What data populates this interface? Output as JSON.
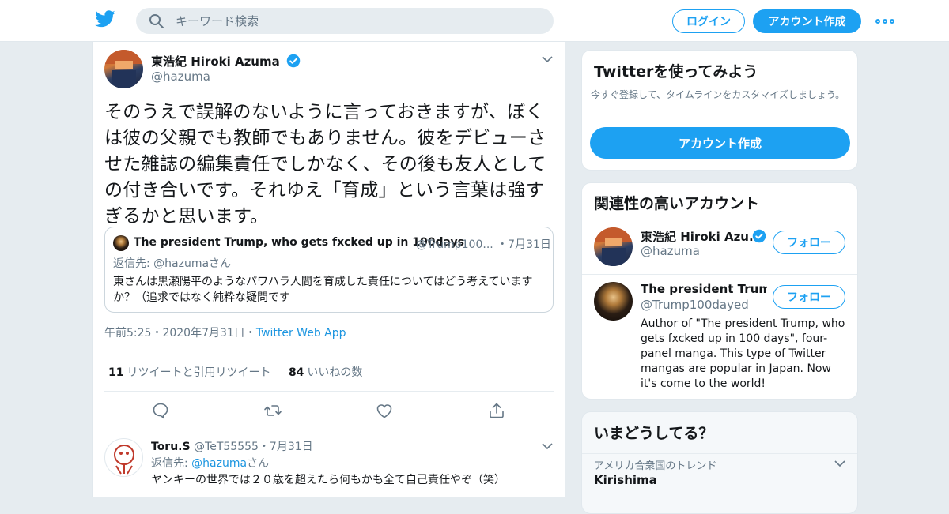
{
  "header": {
    "search_placeholder": "キーワード検索",
    "login_label": "ログイン",
    "signup_label": "アカウント作成",
    "brand_color": "#1da1f2"
  },
  "tweet": {
    "author_name": "東浩紀 Hiroki Azuma",
    "author_handle": "@hazuma",
    "text": "そのうえで誤解のないように言っておきますが、ぼくは彼の父親でも教師でもありません。彼をデビューさせた雑誌の編集責任でしかなく、その後も友人としての付き合いです。それゆえ「育成」という言葉は強すぎるかと思います。",
    "quoted": {
      "author_name": "The president Trump, who gets fxcked up in 100days",
      "author_handle": "@Trump100...",
      "date": "・7月31日",
      "reply_to": "返信先: @hazumaさん",
      "text": "東さんは黒瀬陽平のようなパワハラ人間を育成した責任についてはどう考えていますか？（追求ではなく純粋な疑問です"
    },
    "time": "午前5:25",
    "date": "・2020年7月31日・",
    "source": "Twitter Web App",
    "retweets_count": "11",
    "retweets_label": "リツイートと引用リツイート",
    "likes_count": "84",
    "likes_label": "いいねの数"
  },
  "reply": {
    "author_name": "Toru.S",
    "author_handle": "@TeT55555",
    "date": "・7月31日",
    "reply_prefix": "返信先: ",
    "reply_handle": "@hazuma",
    "reply_suffix": "さん",
    "text": "ヤンキーの世界では２０歳を超えたら何もかも全て自己責任やぞ（笑）"
  },
  "sidebar": {
    "signup_box": {
      "title": "Twitterを使ってみよう",
      "description": "今すぐ登録して、タイムラインをカスタマイズしましょう。",
      "button_label": "アカウント作成"
    },
    "relevant": {
      "title": "関連性の高いアカウント",
      "follow_label": "フォロー",
      "accounts": [
        {
          "name": "東浩紀 Hiroki Azu...",
          "handle": "@hazuma"
        },
        {
          "name": "The president Trump,...",
          "handle": "@Trump100dayed",
          "bio": "Author of \"The president Trump, who gets fxcked up in 100 days\", four-panel manga. This type of Twitter mangas are popular in Japan. Now it's come to the world!"
        }
      ]
    },
    "trends": {
      "title": "いまどうしてる？",
      "context": "アメリカ合衆国のトレンド",
      "name": "Kirishima"
    }
  }
}
